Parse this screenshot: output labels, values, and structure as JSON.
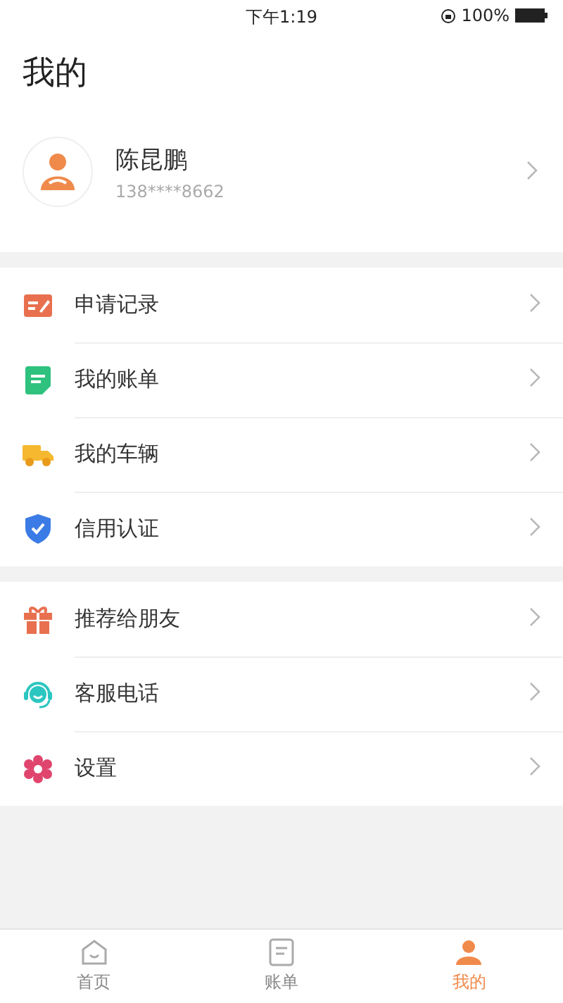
{
  "status_bar": {
    "time": "下午1:19",
    "battery": "100%"
  },
  "title": "我的",
  "profile": {
    "name": "陈昆鹏",
    "phone": "138****8662"
  },
  "menu_groups": [
    {
      "items": [
        {
          "label": "申请记录",
          "kind": "record"
        },
        {
          "label": "我的账单",
          "kind": "bill"
        },
        {
          "label": "我的车辆",
          "kind": "truck"
        },
        {
          "label": "信用认证",
          "kind": "shield"
        }
      ]
    },
    {
      "items": [
        {
          "label": "推荐给朋友",
          "kind": "gift"
        },
        {
          "label": "客服电话",
          "kind": "headset"
        },
        {
          "label": "设置",
          "kind": "gear"
        }
      ]
    }
  ],
  "tabs": [
    {
      "label": "首页",
      "kind": "home",
      "selected": false
    },
    {
      "label": "账单",
      "kind": "bill",
      "selected": false
    },
    {
      "label": "我的",
      "kind": "user",
      "selected": true
    }
  ]
}
